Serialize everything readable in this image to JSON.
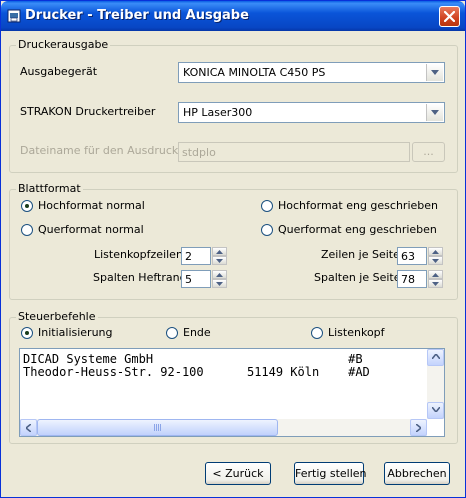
{
  "window": {
    "title": "Drucker - Treiber und Ausgabe"
  },
  "druckerausgabe": {
    "legend": "Druckerausgabe",
    "ausgabegeraet_label": "Ausgabegerät",
    "ausgabegeraet_value": "KONICA MINOLTA C450 PS",
    "treiber_label": "STRAKON Druckertreiber",
    "treiber_value": "HP Laser300",
    "dateiname_label": "Dateiname für den Ausdruck",
    "dateiname_value": "stdplo",
    "browse_label": "..."
  },
  "blattformat": {
    "legend": "Blattformat",
    "radios": [
      {
        "label": "Hochformat normal",
        "checked": true
      },
      {
        "label": "Querformat normal",
        "checked": false
      },
      {
        "label": "Hochformat eng geschrieben",
        "checked": false
      },
      {
        "label": "Querformat eng geschrieben",
        "checked": false
      }
    ],
    "listenkopfzeilen_label": "Listenkopfzeilen",
    "listenkopfzeilen_value": "2",
    "spalten_heftrand_label": "Spalten Heftrand",
    "spalten_heftrand_value": "5",
    "zeilen_je_seite_label": "Zeilen je Seite",
    "zeilen_je_seite_value": "63",
    "spalten_je_seite_label": "Spalten je Seite",
    "spalten_je_seite_value": "78"
  },
  "steuerbefehle": {
    "legend": "Steuerbefehle",
    "radios": [
      {
        "label": "Initialisierung",
        "checked": true
      },
      {
        "label": "Ende",
        "checked": false
      },
      {
        "label": "Listenkopf",
        "checked": false
      }
    ],
    "editor_lines": [
      "DICAD Systeme GmbH                           #B",
      "Theodor-Heuss-Str. 92-100      51149 Köln    #AD"
    ]
  },
  "footer": {
    "back_label": "< Zurück",
    "finish_label": "Fertig stellen",
    "cancel_label": "Abbrechen"
  }
}
